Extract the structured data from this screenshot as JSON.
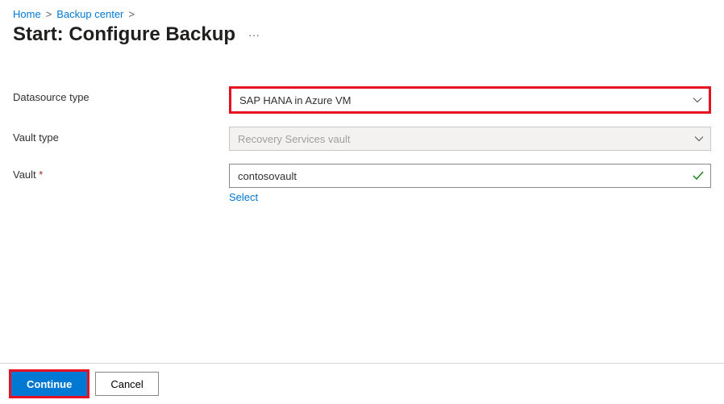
{
  "breadcrumb": {
    "home": "Home",
    "backup_center": "Backup center"
  },
  "page": {
    "title": "Start: Configure Backup",
    "ellipsis": "···"
  },
  "form": {
    "datasource": {
      "label": "Datasource type",
      "value": "SAP HANA in Azure VM"
    },
    "vault_type": {
      "label": "Vault type",
      "value": "Recovery Services vault"
    },
    "vault": {
      "label": "Vault",
      "required": "*",
      "value": "contosovault",
      "select_link": "Select"
    }
  },
  "footer": {
    "continue": "Continue",
    "cancel": "Cancel"
  }
}
